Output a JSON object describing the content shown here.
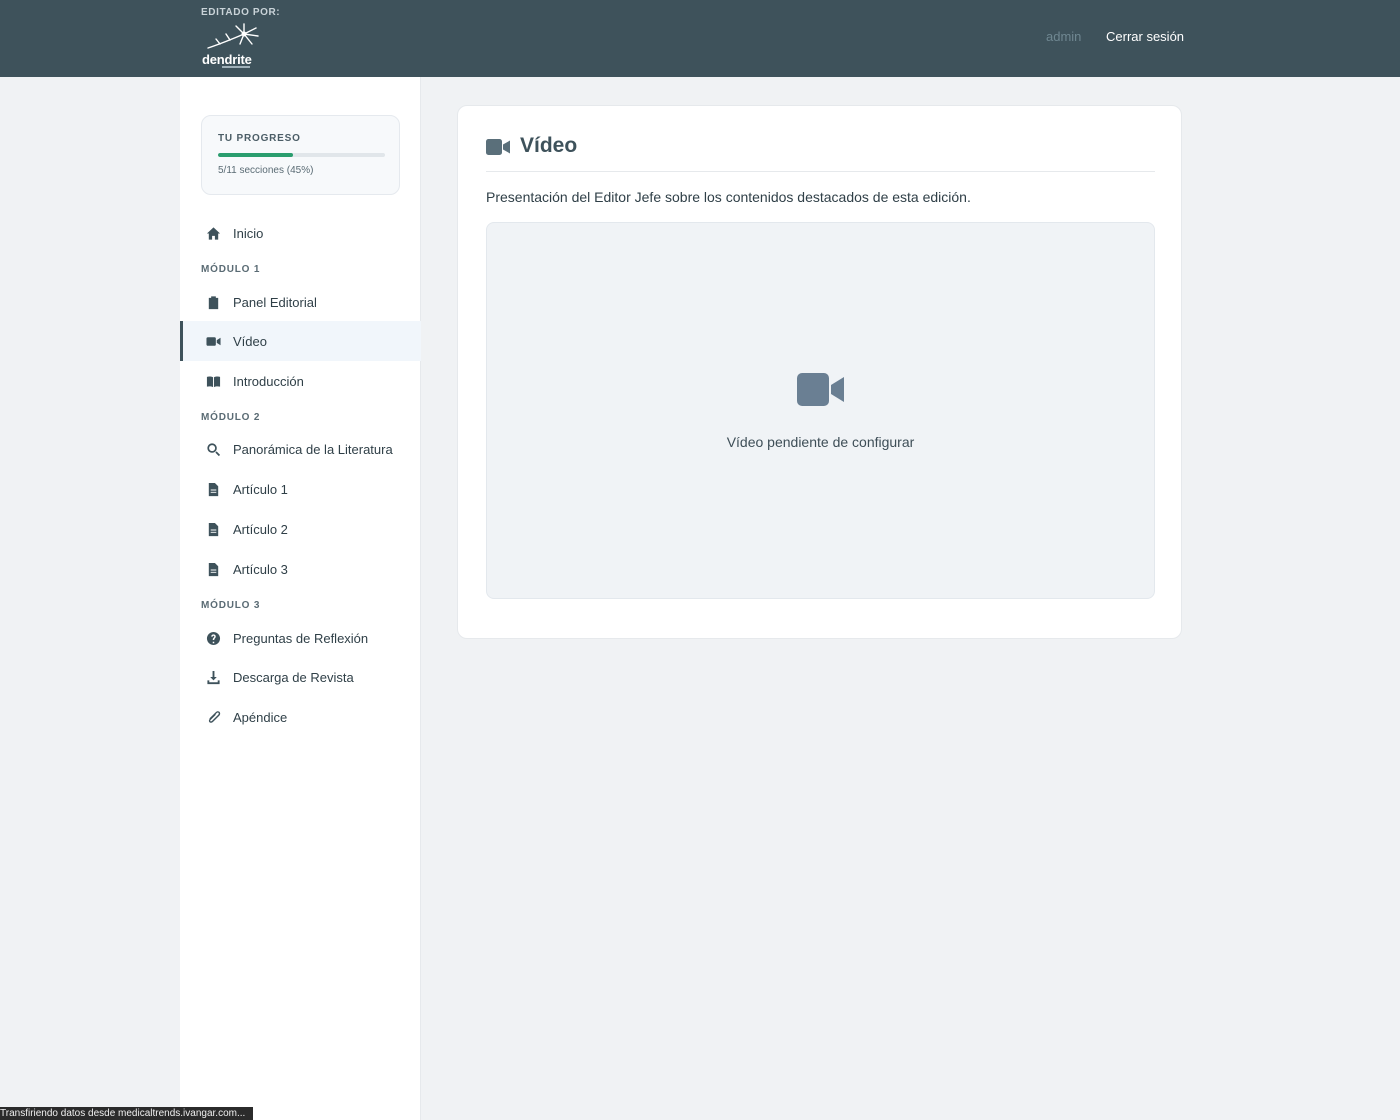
{
  "header": {
    "edited_by": "EDITADO POR:",
    "logo_text": "dendrite",
    "user": "admin",
    "logout": "Cerrar sesión"
  },
  "sidebar": {
    "progress": {
      "title": "TU PROGRESO",
      "text": "5/11 secciones (45%)",
      "fraction": 0.45
    },
    "home": {
      "label": "Inicio",
      "icon": "home-icon"
    },
    "modules": [
      {
        "label": "MÓDULO 1"
      },
      {
        "label": "MÓDULO 2"
      },
      {
        "label": "MÓDULO 3"
      }
    ],
    "items": [
      {
        "label": "Panel Editorial",
        "icon": "clipboard-icon"
      },
      {
        "label": "Vídeo",
        "icon": "video-camera-icon",
        "active": true
      },
      {
        "label": "Introducción",
        "icon": "book-open-icon"
      },
      {
        "label": "Panorámica de la Literatura",
        "icon": "search-icon"
      },
      {
        "label": "Artículo 1",
        "icon": "document-icon"
      },
      {
        "label": "Artículo 2",
        "icon": "document-icon"
      },
      {
        "label": "Artículo 3",
        "icon": "document-icon"
      },
      {
        "label": "Preguntas de Reflexión",
        "icon": "question-circle-icon"
      },
      {
        "label": "Descarga de Revista",
        "icon": "download-icon"
      },
      {
        "label": "Apéndice",
        "icon": "paperclip-icon"
      }
    ]
  },
  "main": {
    "title": "Vídeo",
    "description": "Presentación del Editor Jefe sobre los contenidos destacados de esta edición.",
    "video_placeholder": "Vídeo pendiente de configurar"
  },
  "status_bar": "Transfiriendo datos desde medicaltrends.ivangar.com...",
  "colors": {
    "header_bg": "#3e525b",
    "progress": "#2a9d6e",
    "accent": "#3e525b"
  }
}
